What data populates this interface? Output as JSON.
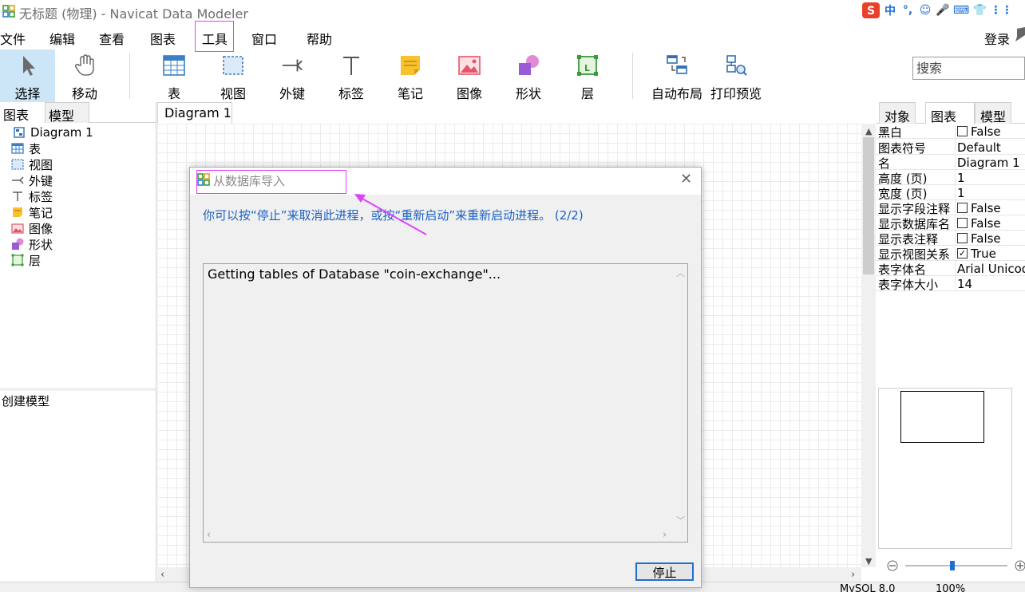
{
  "window": {
    "title": "无标题 (物理) - Navicat Data Modeler",
    "tray": [
      "中",
      "°,",
      "☺",
      "🎤",
      "⌨",
      "👕",
      "⋮⋮"
    ]
  },
  "menu": {
    "items": [
      "文件",
      "编辑",
      "查看",
      "图表",
      "工具",
      "窗口",
      "帮助"
    ],
    "login": "登录"
  },
  "toolbar": {
    "tools": [
      {
        "label": "选择",
        "icon": "pointer-icon"
      },
      {
        "label": "移动",
        "icon": "hand-icon"
      },
      {
        "label": "表",
        "icon": "table-icon"
      },
      {
        "label": "视图",
        "icon": "view-icon"
      },
      {
        "label": "外键",
        "icon": "foreign-key-icon"
      },
      {
        "label": "标签",
        "icon": "label-icon"
      },
      {
        "label": "笔记",
        "icon": "note-icon"
      },
      {
        "label": "图像",
        "icon": "image-icon"
      },
      {
        "label": "形状",
        "icon": "shape-icon"
      },
      {
        "label": "层",
        "icon": "layer-icon"
      },
      {
        "label": "自动布局",
        "icon": "auto-layout-icon"
      },
      {
        "label": "打印预览",
        "icon": "print-preview-icon"
      }
    ],
    "search_placeholder": "搜索"
  },
  "left_panel": {
    "tabs": [
      "图表",
      "模型"
    ],
    "tree": [
      "Diagram 1",
      "表",
      "视图",
      "外键",
      "标签",
      "笔记",
      "图像",
      "形状",
      "层"
    ],
    "bottom_label": "创建模型"
  },
  "document": {
    "tab": "Diagram 1"
  },
  "right_panel": {
    "tabs": [
      "对象",
      "图表",
      "模型"
    ],
    "properties": [
      {
        "name": "黑白",
        "value": "False",
        "checkbox": true,
        "checked": false
      },
      {
        "name": "图表符号",
        "value": "Default"
      },
      {
        "name": "名",
        "value": "Diagram 1"
      },
      {
        "name": "高度 (页)",
        "value": "1"
      },
      {
        "name": "宽度 (页)",
        "value": "1"
      },
      {
        "name": "显示字段注释",
        "value": "False",
        "checkbox": true,
        "checked": false
      },
      {
        "name": "显示数据库名",
        "value": "False",
        "checkbox": true,
        "checked": false
      },
      {
        "name": "显示表注释",
        "value": "False",
        "checkbox": true,
        "checked": false
      },
      {
        "name": "显示视图关系",
        "value": "True",
        "checkbox": true,
        "checked": true
      },
      {
        "name": "表字体名",
        "value": "Arial Unicode"
      },
      {
        "name": "表字体大小",
        "value": "14"
      }
    ]
  },
  "status": {
    "db": "MySQL 8.0",
    "zoom": "100%"
  },
  "dialog": {
    "title": "从数据库导入",
    "message": "你可以按“停止”来取消此进程，或按“重新启动”来重新启动进程。 (2/2)",
    "log": "Getting tables of Database \"coin-exchange\"...",
    "stop_label": "停止"
  },
  "colors": {
    "annotation": "#e040fb",
    "message_text": "#1b62c4",
    "selected_tool_bg": "#cde6f7"
  }
}
